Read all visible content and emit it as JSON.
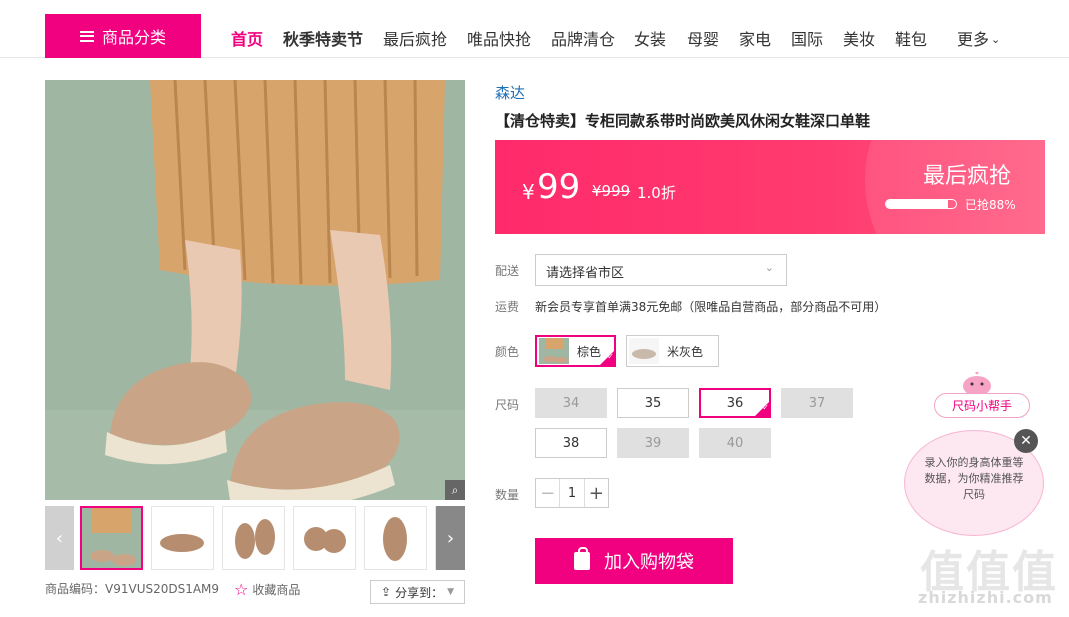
{
  "nav": {
    "category_btn": "商品分类",
    "items": [
      "首页",
      "秋季特卖节",
      "最后疯抢",
      "唯品快抢",
      "品牌清仓",
      "女装",
      "母婴",
      "家电",
      "国际",
      "美妆",
      "鞋包"
    ],
    "more": "更多"
  },
  "product": {
    "brand": "森达",
    "title": "【清仓特卖】专柜同款系带时尚欧美风休闲女鞋深口单鞋",
    "currency": "¥",
    "price": "99",
    "orig_price": "¥999",
    "discount": "1.0折",
    "flash_label": "最后疯抢",
    "sold_label": "已抢88%",
    "sold_fraction": 0.88,
    "code": "商品编码：V91VUS20DS1AM9",
    "fav_label": "收藏商品",
    "share_label": "分享到："
  },
  "options": {
    "delivery_label": "配送",
    "region_placeholder": "请选择省市区",
    "freight_label": "运费",
    "freight_text": "新会员专享首单满38元免邮（限唯品自营商品，部分商品不可用）",
    "color_label": "颜色",
    "colors": [
      "棕色",
      "米灰色"
    ],
    "size_label": "尺码",
    "sizes": [
      "34",
      "35",
      "36",
      "37",
      "38",
      "39",
      "40"
    ],
    "qty_label": "数量",
    "qty": "1"
  },
  "cart_label": "加入购物袋",
  "helper": {
    "tag": "尺码小帮手",
    "bubble": "录入你的身高体重等数据，为你精准推荐尺码"
  },
  "watermark": {
    "big": "值值值",
    "small": "zhizhizhi.com"
  },
  "colors": {
    "accent": "#f10180",
    "price_bg": "#ff2a6b",
    "link": "#1f6fb4"
  }
}
